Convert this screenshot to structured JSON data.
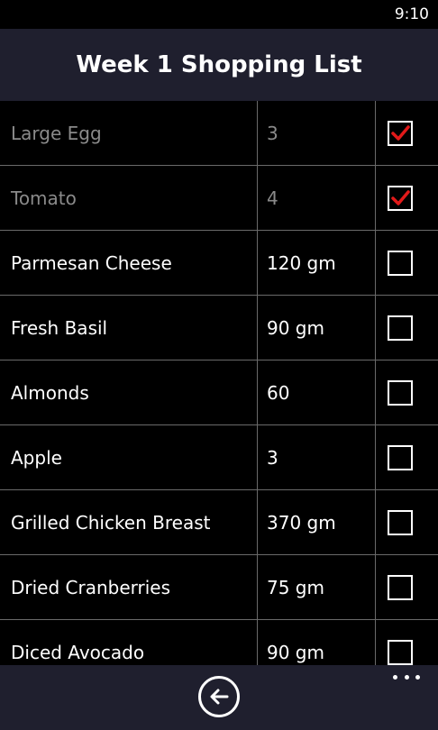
{
  "status_bar": {
    "time": "9:10"
  },
  "header": {
    "title": "Week 1 Shopping List"
  },
  "items": [
    {
      "name": "Large Egg",
      "qty": "3",
      "checked": true
    },
    {
      "name": "Tomato",
      "qty": "4",
      "checked": true
    },
    {
      "name": "Parmesan Cheese",
      "qty": "120 gm",
      "checked": false
    },
    {
      "name": "Fresh Basil",
      "qty": "90 gm",
      "checked": false
    },
    {
      "name": "Almonds",
      "qty": "60",
      "checked": false
    },
    {
      "name": "Apple",
      "qty": "3",
      "checked": false
    },
    {
      "name": "Grilled Chicken Breast",
      "qty": "370 gm",
      "checked": false
    },
    {
      "name": "Dried Cranberries",
      "qty": "75 gm",
      "checked": false
    },
    {
      "name": "Diced Avocado",
      "qty": "90 gm",
      "checked": false
    }
  ],
  "app_bar": {
    "back_icon": "back-arrow-circle-icon",
    "more_icon": "ellipsis-icon"
  },
  "colors": {
    "check_mark": "#e21a1a",
    "header_bg": "#1f1f2e",
    "divider": "#6a6a6a"
  }
}
